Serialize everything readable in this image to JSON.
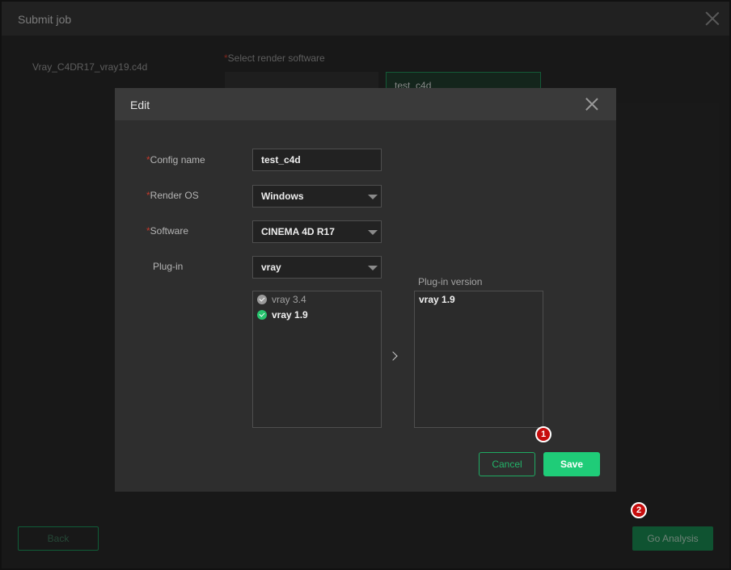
{
  "window": {
    "title": "Submit job",
    "close_icon": "close-icon"
  },
  "job": {
    "file_name": "Vray_C4DR17_vray19.c4d",
    "required_mark": "*",
    "select_software_label": "Select render software",
    "selected_card_text": "test_c4d"
  },
  "footer": {
    "back_label": "Back",
    "go_analysis_label": "Go Analysis"
  },
  "modal": {
    "title": "Edit",
    "close_icon": "close-icon",
    "required_mark": "*",
    "fields": {
      "config_name_label": "Config name",
      "config_name_value": "test_c4d",
      "render_os_label": "Render OS",
      "render_os_value": "Windows",
      "software_label": "Software",
      "software_value": "CINEMA 4D R17",
      "plugin_label": "Plug-in",
      "plugin_value": "vray"
    },
    "plugin_options": [
      {
        "label": "vray 3.4",
        "checked_color": "#9a9a9a",
        "state": "available"
      },
      {
        "label": "vray 1.9",
        "checked_color": "#27c46e",
        "state": "selected"
      }
    ],
    "plugin_version_label": "Plug-in version",
    "selected_versions": [
      "vray 1.9"
    ],
    "transfer_icon": "chevron-right-icon",
    "cancel_label": "Cancel",
    "save_label": "Save"
  },
  "annotations": {
    "step_1": "1",
    "step_2": "2"
  },
  "colors": {
    "accent_green": "#1fcc78",
    "badge_red": "#c60d0d",
    "required_red": "#c0392b"
  }
}
